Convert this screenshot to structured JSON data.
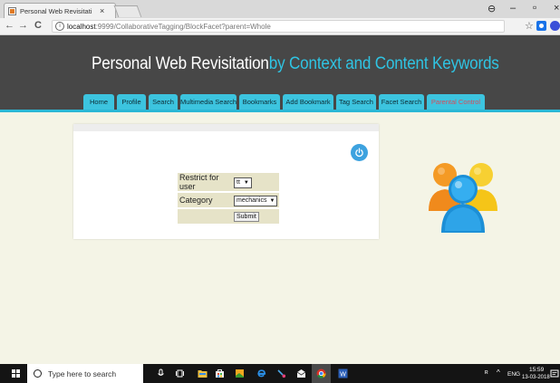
{
  "browser": {
    "tab_title": "Personal Web Revisitati",
    "tab_close": "×",
    "url_host": "localhost",
    "url_path": ":9999/CollaborativeTagging/BlockFacet?parent=Whole",
    "nav": {
      "back": "←",
      "forward": "→",
      "reload": "C"
    },
    "window_controls": {
      "account": "⊖",
      "minimize": "–",
      "restore": "▫",
      "close": "×"
    }
  },
  "site": {
    "title_part1": "Personal Web Revisitation",
    "title_part2": "by Context and Content Keywords",
    "nav": [
      {
        "label": "Home"
      },
      {
        "label": "Profile"
      },
      {
        "label": "Search"
      },
      {
        "label": "Multimedia Search"
      },
      {
        "label": "Bookmarks"
      },
      {
        "label": "Add Bookmark"
      },
      {
        "label": "Tag Search"
      },
      {
        "label": "Facet Search"
      },
      {
        "label": "Parental Control"
      }
    ]
  },
  "form": {
    "restrict_label": "Restrict for user",
    "restrict_value": "tt",
    "category_label": "Category",
    "category_value": "mechanics",
    "submit_label": "Submit"
  },
  "taskbar": {
    "search_placeholder": "Type here to search",
    "lang": "ENG",
    "time": "15:59",
    "date": "13-03-2018"
  },
  "colors": {
    "header_bg": "#474747",
    "title_accent": "#2fc4e3",
    "nav_tab": "#3cc4df",
    "parental_text": "#d84b5a",
    "page_bg": "#f4f4e6",
    "form_cell": "#e6e3c8",
    "power_button": "#3da2df"
  }
}
